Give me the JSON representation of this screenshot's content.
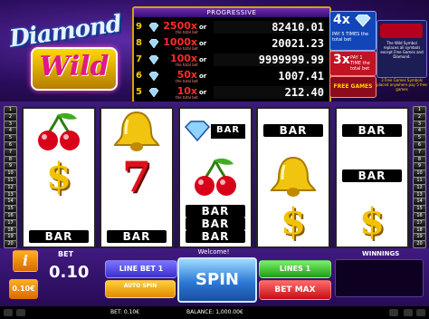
{
  "game": {
    "logo_line1": "Diamond",
    "logo_line2": "Wild"
  },
  "paytable": {
    "header": "PROGRESSIVE",
    "rows": [
      {
        "count": "9",
        "multiplier": "2500x",
        "sub": "the total bet",
        "or": "or",
        "value": "82410.01"
      },
      {
        "count": "8",
        "multiplier": "1000x",
        "sub": "the total bet",
        "or": "or",
        "value": "20021.23"
      },
      {
        "count": "7",
        "multiplier": "100x",
        "sub": "the total bet",
        "or": "or",
        "value": "9999999.99"
      },
      {
        "count": "6",
        "multiplier": "50x",
        "sub": "the total bet",
        "or": "or",
        "value": "1007.41"
      },
      {
        "count": "5",
        "multiplier": "10x",
        "sub": "the total bet",
        "or": "or",
        "value": "212.40"
      }
    ]
  },
  "bonus": {
    "mult4_big": "4x",
    "mult4_text": "PAY 5 TIMES the total bet",
    "mult3_big": "3x",
    "mult3_text": "PAY 1 TIME the total bet",
    "wild_text": "The Wild Symbol replaces all symbols except Free Games and Diamond.",
    "free_games_label": "FREE GAMES",
    "free_games_text": "3 Free Games Symbols placed anywhere pay 5 free games"
  },
  "lines_left": [
    "1",
    "2",
    "3",
    "4",
    "5",
    "6",
    "7",
    "8",
    "9",
    "10",
    "11",
    "12",
    "13",
    "14",
    "15",
    "16",
    "17",
    "18",
    "19",
    "20"
  ],
  "lines_right": [
    "1",
    "2",
    "3",
    "4",
    "5",
    "6",
    "7",
    "8",
    "9",
    "10",
    "11",
    "12",
    "13",
    "14",
    "15",
    "16",
    "17",
    "18",
    "19",
    "20"
  ],
  "reels": [
    [
      "cherry",
      "dollar",
      "bar"
    ],
    [
      "bell",
      "seven",
      "bar"
    ],
    [
      "diamond",
      "cherry",
      "bar"
    ],
    [
      "bar",
      "bell",
      "dollar"
    ],
    [
      "bar",
      "bar",
      "dollar"
    ]
  ],
  "symbol_text": {
    "bar": "BAR",
    "dollar": "$",
    "seven": "7",
    "diamond": "BAR"
  },
  "controls": {
    "info": "i",
    "stake": "0.10€",
    "bet_label": "BET",
    "bet_value": "0.10",
    "message": "Welcome!",
    "winnings_label": "WINNINGS",
    "line_bet": "LINE BET 1",
    "auto_spin": "AUTO SPIN",
    "spin": "SPIN",
    "lines": "LINES 1",
    "bet_max": "BET MAX"
  },
  "status": {
    "bet": "BET: 0.10€",
    "balance": "BALANCE: 1,000.00€"
  },
  "colors": {
    "gold": "#f2c200",
    "red": "#e0101a",
    "purple_bg": "#2a0d5c"
  }
}
